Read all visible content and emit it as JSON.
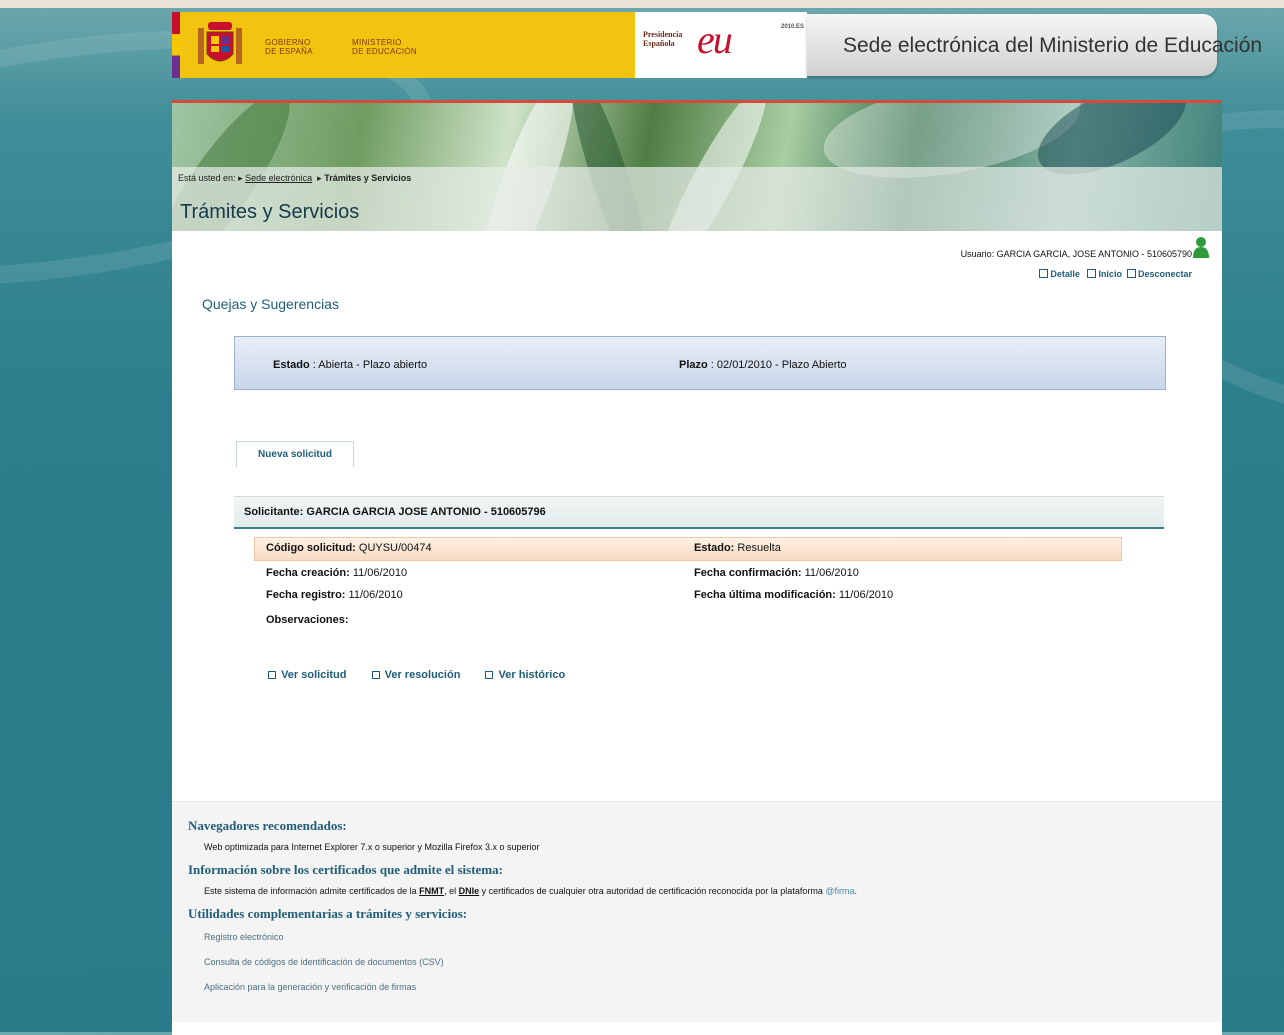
{
  "header": {
    "gov_line1": "GOBIERNO",
    "gov_line2": "DE ESPAÑA",
    "ministry_line1": "MINISTERIO",
    "ministry_line2": "DE EDUCACIÓN",
    "presidency_line1": "Presidencia",
    "presidency_line2": "Española",
    "eu_mark": "eu",
    "eu_year": "2010.ES",
    "site_title": "Sede electrónica del Ministerio de Educación"
  },
  "breadcrumb": {
    "prefix": "Está usted en:",
    "link": "Sede electrónica",
    "current": "Trámites y Servicios"
  },
  "page_title": "Trámites y Servicios",
  "user": {
    "label": "Usuario: GARCIA GARCIA, JOSE ANTONIO - 510605790",
    "links": [
      "Detalle",
      "Inicio",
      "Desconectar"
    ]
  },
  "section_title": "Quejas y Sugerencias",
  "status": {
    "estado_label": "Estado",
    "estado_value": " : Abierta - Plazo abierto",
    "plazo_label": "Plazo",
    "plazo_value": " : 02/01/2010 - Plazo Abierto"
  },
  "new_request_label": "Nueva solicitud",
  "applicant": "Solicitante: GARCIA  GARCIA   JOSE ANTONIO  - 510605796",
  "request": {
    "codigo_label": "Código solicitud:",
    "codigo_value": " QUYSU/00474",
    "estado_label": "Estado:",
    "estado_value": " Resuelta",
    "creacion_label": "Fecha creación:",
    "creacion_value": " 11/06/2010",
    "confirmacion_label": "Fecha confirmación:",
    "confirmacion_value": " 11/06/2010",
    "registro_label": "Fecha registro:",
    "registro_value": " 11/06/2010",
    "modificacion_label": "Fecha última modificación:",
    "modificacion_value": " 11/06/2010",
    "observaciones_label": "Observaciones:"
  },
  "actions": [
    "Ver solicitud",
    "Ver resolución",
    "Ver histórico"
  ],
  "footer": {
    "browsers_title": "Navegadores recomendados:",
    "browsers_text": "Web optimizada para Internet Explorer 7.x o superior y Mozilla Firefox 3.x o superior",
    "certs_title": "Información sobre los certificados que admite el sistema:",
    "certs_text_1": "Este sistema de información admite certificados de la ",
    "certs_fnmt": "FNMT",
    "certs_text_2": ", el ",
    "certs_dnie": "DNIe",
    "certs_text_3": " y certificados de cualquier otra autoridad de certificación reconocida por la plataforma ",
    "certs_firma": "@firma",
    "certs_text_4": ".",
    "utils_title": "Utilidades complementarias a trámites y servicios:",
    "utils_links": [
      "Registro electrónico",
      "Consulta de códigos de identificación de documentos (CSV)",
      "Aplicación para la generación y verificación de firmas"
    ]
  },
  "colors": {
    "accent": "#1f5d78",
    "header_yellow": "#f2c40f",
    "banner_red_line": "#d64a3a",
    "user_icon": "#2f9a3a"
  }
}
